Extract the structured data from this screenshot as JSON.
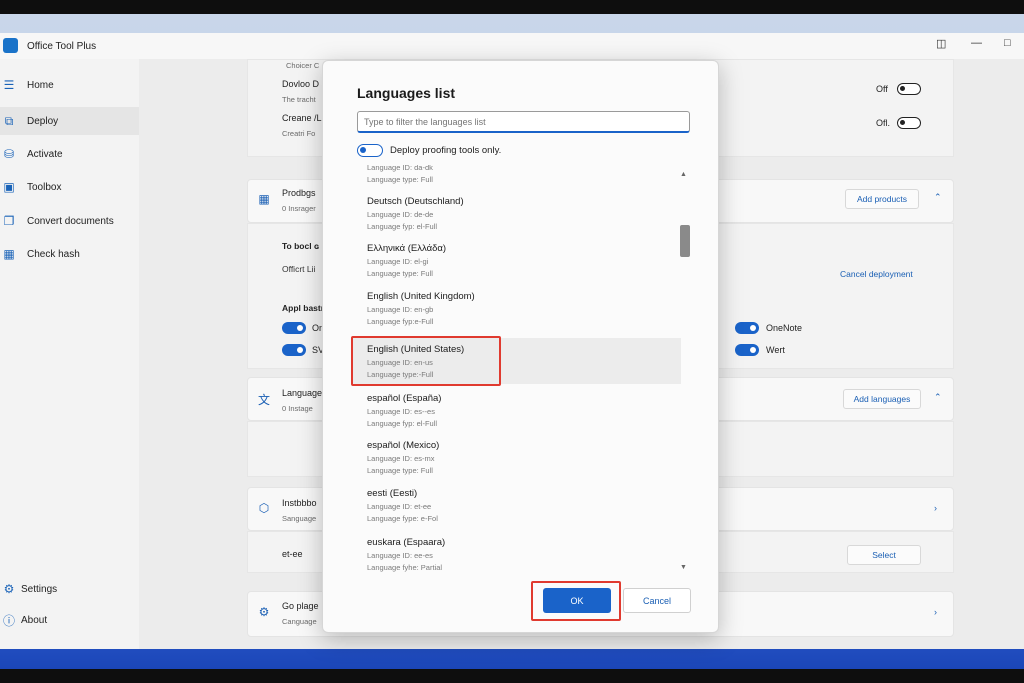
{
  "app": {
    "title": "Office Tool Plus"
  },
  "sidebar": {
    "items": [
      {
        "label": "Home",
        "icon": "menu-icon"
      },
      {
        "label": "Deploy",
        "icon": "deploy-icon"
      },
      {
        "label": "Activate",
        "icon": "gamepad-icon"
      },
      {
        "label": "Toolbox",
        "icon": "toolbox-icon"
      },
      {
        "label": "Convert documents",
        "icon": "convert-icon"
      },
      {
        "label": "Check hash",
        "icon": "hash-icon"
      }
    ],
    "bottom": [
      {
        "label": "Settings",
        "icon": "gear-icon"
      },
      {
        "label": "About",
        "icon": "info-icon"
      }
    ]
  },
  "main": {
    "top_card": {
      "frag1": "Choicer C",
      "row1_title": "Dovloo D",
      "row1_desc": "The tracht",
      "row1_state": "Off",
      "row2_title": "Creane /L",
      "row2_desc": "Creatri Fo",
      "row2_state": "Ofl."
    },
    "products": {
      "title": "Prodbgs",
      "subtitle": "0 Insrager",
      "add_button": "Add products",
      "to_book": "To bocl ɢ",
      "office_frag": "Officrt Lii",
      "cancel_link": "Cancel deployment",
      "apps_title": "Appl bastr",
      "app1": "On",
      "app2": "SV",
      "app3": "OneNote",
      "app4": "Wert"
    },
    "languages": {
      "title": "Language",
      "subtitle": "0 Instage",
      "add_button": "Add languages"
    },
    "install": {
      "title": "Instbbbo",
      "subtitle": "Sanguage",
      "value": "et-ee",
      "select_button": "Select"
    },
    "go_page": {
      "title": "Go plage",
      "subtitle": "Canguage"
    }
  },
  "dialog": {
    "title": "Languages list",
    "filter_placeholder": "Type to filter the languages list",
    "proofing_label": "Deploy proofing tools only.",
    "languages": [
      {
        "name": "",
        "id": "Language ID: da-dk",
        "type": "Language type: Full"
      },
      {
        "name": "Deutsch (Deutschland)",
        "id": "Language ID: de-de",
        "type": "Language fyp: el-Full"
      },
      {
        "name": "Ελληνικά (Ελλάδα)",
        "id": "Language ID: el-gi",
        "type": "Language type: Full"
      },
      {
        "name": "English (United Kingdom)",
        "id": "Language ID: en-gb",
        "type": "Language fyp:e-Full"
      },
      {
        "name": "English (United States)",
        "id": "Language ID: en-us",
        "type": "Language type:-Full"
      },
      {
        "name": "español (España)",
        "id": "Language ID: es--es",
        "type": "Language fyp: el-Full"
      },
      {
        "name": "español (Mexico)",
        "id": "Language ID: es-mx",
        "type": "Language type: Full"
      },
      {
        "name": "eesti (Eesti)",
        "id": "Language ID: et-ee",
        "type": "Language fype: e-Fol"
      },
      {
        "name": "euskara (Espaara)",
        "id": "Language ID: ee-es",
        "type": "Language fyhe: Partial"
      }
    ],
    "ok_label": "OK",
    "cancel_label": "Cancel"
  },
  "colors": {
    "accent": "#1a63c9",
    "highlight_box": "#e03a2f",
    "link": "#1a5fb4"
  }
}
